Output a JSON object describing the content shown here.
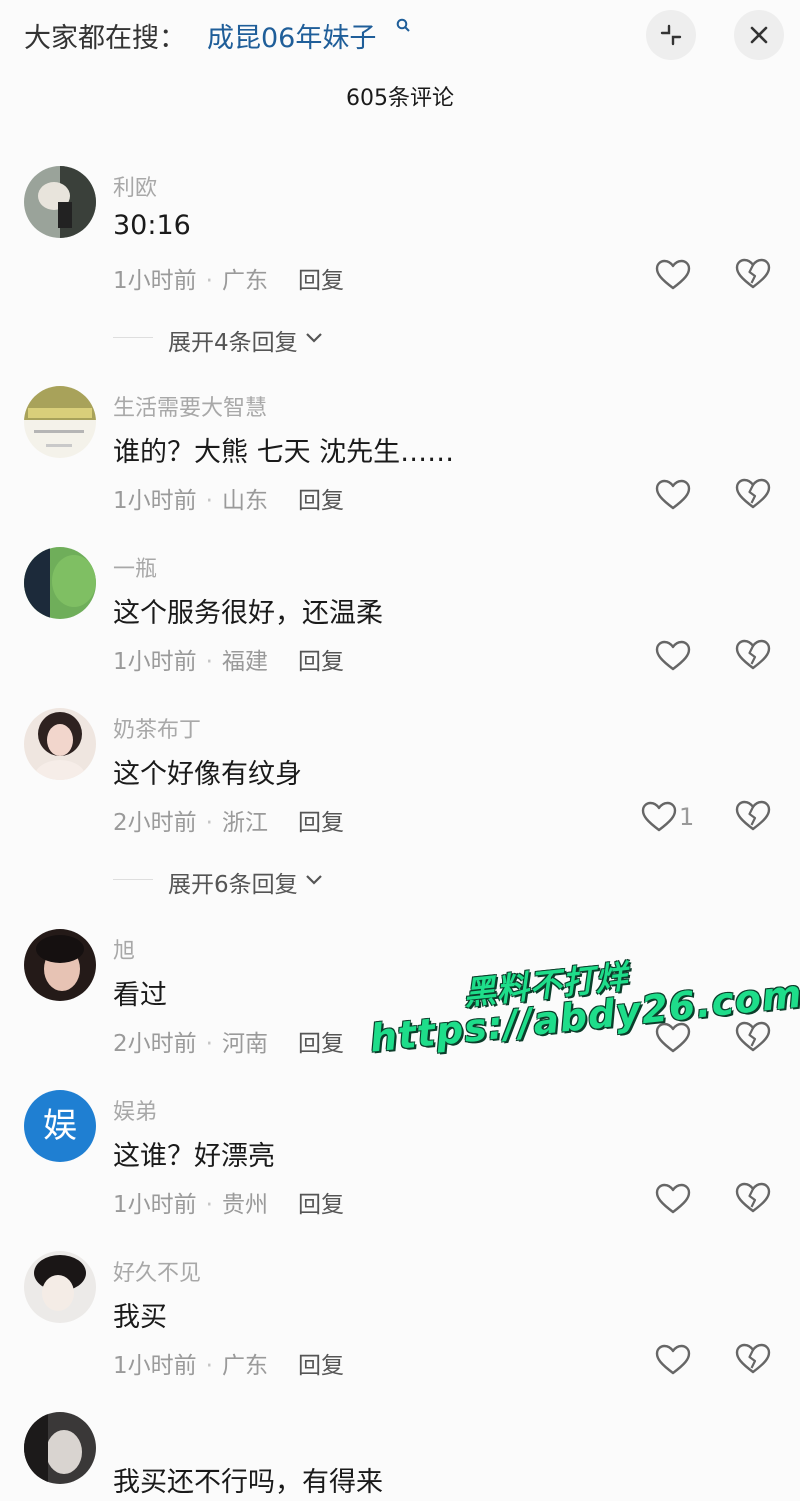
{
  "header": {
    "search_prefix": "大家都在搜：",
    "search_term": "成昆06年妹子",
    "search_icon": "search-icon",
    "collapse_icon": "collapse-icon",
    "close_icon": "close-icon",
    "link_color": "#1f5e99"
  },
  "comment_count": "605条评论",
  "comments": [
    {
      "user": "利欧",
      "text": "30:16",
      "time": "1小时前",
      "region": "广东",
      "reply": "回复",
      "likes": ""
    },
    {
      "user": "生活需要大智慧",
      "text": "谁的？大熊 七天 沈先生……",
      "time": "1小时前",
      "region": "山东",
      "reply": "回复",
      "likes": ""
    },
    {
      "user": "一瓶",
      "text": "这个服务很好，还温柔",
      "time": "1小时前",
      "region": "福建",
      "reply": "回复",
      "likes": ""
    },
    {
      "user": "奶茶布丁",
      "text": "这个好像有纹身",
      "time": "2小时前",
      "region": "浙江",
      "reply": "回复",
      "likes": "1"
    },
    {
      "user": "旭",
      "text": "看过",
      "time": "2小时前",
      "region": "河南",
      "reply": "回复",
      "likes": ""
    },
    {
      "user": "娱弟",
      "avatar_text": "娱",
      "text": "这谁？好漂亮",
      "time": "1小时前",
      "region": "贵州",
      "reply": "回复",
      "likes": ""
    },
    {
      "user": "好久不见",
      "text": "我买",
      "time": "1小时前",
      "region": "广东",
      "reply": "回复",
      "likes": ""
    },
    {
      "user": "",
      "text": "我买还不行吗，有得来",
      "time": "",
      "region": "",
      "reply": "",
      "likes": ""
    }
  ],
  "expand_replies": [
    {
      "label": "展开4条回复"
    },
    {
      "label": "展开6条回复"
    }
  ],
  "watermark": {
    "line1": "黑料不打烊",
    "line2": "https://abdy26.com",
    "color": "#1edd8a"
  }
}
